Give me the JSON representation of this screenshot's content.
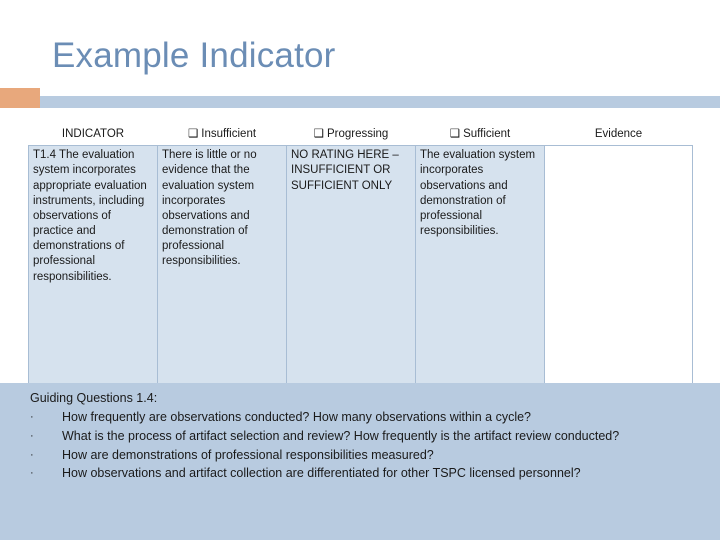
{
  "slide": {
    "title": "Example Indicator"
  },
  "table": {
    "headers": [
      {
        "label": "INDICATOR",
        "checkbox": false
      },
      {
        "label": "Insufficient",
        "checkbox": true
      },
      {
        "label": "Progressing",
        "checkbox": true
      },
      {
        "label": "Sufficient",
        "checkbox": true
      },
      {
        "label": "Evidence",
        "checkbox": false
      }
    ],
    "checkbox_glyph": "❑",
    "row": {
      "indicator": "T1.4   The evaluation system incorporates appropriate evaluation instruments, including observations of practice and demonstrations of professional responsibilities.",
      "insufficient": "There is little or no evidence that the evaluation system incorporates observations and demonstration of professional responsibilities.",
      "progressing": "NO RATING HERE – INSUFFICIENT OR SUFFICIENT ONLY",
      "sufficient": "The evaluation system incorporates observations and demonstration of professional responsibilities.",
      "evidence": ""
    }
  },
  "guiding": {
    "title": "Guiding Questions 1.4:",
    "bullet": "·",
    "questions": [
      "How frequently are observations conducted? How many observations within a cycle?",
      "What is the process of artifact selection and review? How frequently is the artifact review conducted?",
      "How are demonstrations of professional responsibilities measured?",
      "How observations and artifact collection are differentiated for other TSPC licensed personnel?"
    ]
  },
  "colors": {
    "title": "#6b8db5",
    "accent_bar": "#b8cbe0",
    "accent_square": "#e8a87c",
    "cell_fill": "#d6e2ee",
    "border": "#a8bdd4"
  }
}
